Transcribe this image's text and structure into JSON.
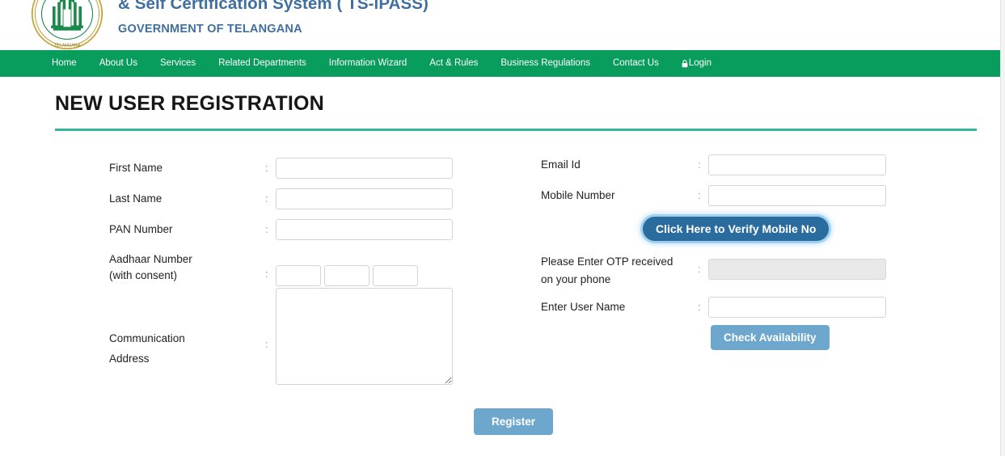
{
  "header": {
    "logo_icon": "telangana-state-emblem",
    "title_line1": "& Self Certification System ( TS-iPASS)",
    "title_line2": "GOVERNMENT OF TELANGANA",
    "title_color": "#3f6f9f"
  },
  "nav": {
    "background_color": "#089c5d",
    "items": [
      {
        "label": "Home",
        "icon": null
      },
      {
        "label": "About Us",
        "icon": null
      },
      {
        "label": "Services",
        "icon": null
      },
      {
        "label": "Related Departments",
        "icon": null
      },
      {
        "label": "Information Wizard",
        "icon": null
      },
      {
        "label": "Act & Rules",
        "icon": null
      },
      {
        "label": "Business Regulations",
        "icon": null
      },
      {
        "label": "Contact Us",
        "icon": null
      },
      {
        "label": "Login",
        "icon": "lock-icon"
      }
    ]
  },
  "page": {
    "title": "NEW USER REGISTRATION",
    "rule_color": "#35b79a"
  },
  "form": {
    "colon": ":",
    "left": {
      "first_name": {
        "label": "First Name",
        "value": "",
        "placeholder": ""
      },
      "last_name": {
        "label": "Last Name",
        "value": "",
        "placeholder": ""
      },
      "pan_number": {
        "label": "PAN Number",
        "value": "",
        "placeholder": ""
      },
      "aadhaar": {
        "label_line1": "Aadhaar Number",
        "label_line2": "(with consent)",
        "segments": [
          "",
          "",
          ""
        ]
      },
      "address": {
        "label_line1": "Communication",
        "label_line2": "Address",
        "value": "",
        "placeholder": ""
      }
    },
    "right": {
      "email": {
        "label": "Email Id",
        "value": "",
        "placeholder": ""
      },
      "mobile": {
        "label": "Mobile Number",
        "value": "",
        "placeholder": ""
      },
      "verify_button": {
        "label": "Click Here to Verify Mobile No",
        "color": "#2a6c9e",
        "focused": true
      },
      "otp": {
        "label_line1": "Please Enter OTP received",
        "label_line2": "on your phone",
        "value": "",
        "placeholder": "",
        "disabled": true
      },
      "username": {
        "label": "Enter User Name",
        "value": "",
        "placeholder": ""
      },
      "check_button": {
        "label": "Check Availability",
        "color": "#6ea7cd"
      }
    },
    "register_button": {
      "label": "Register",
      "color": "#6ea7cd"
    }
  }
}
